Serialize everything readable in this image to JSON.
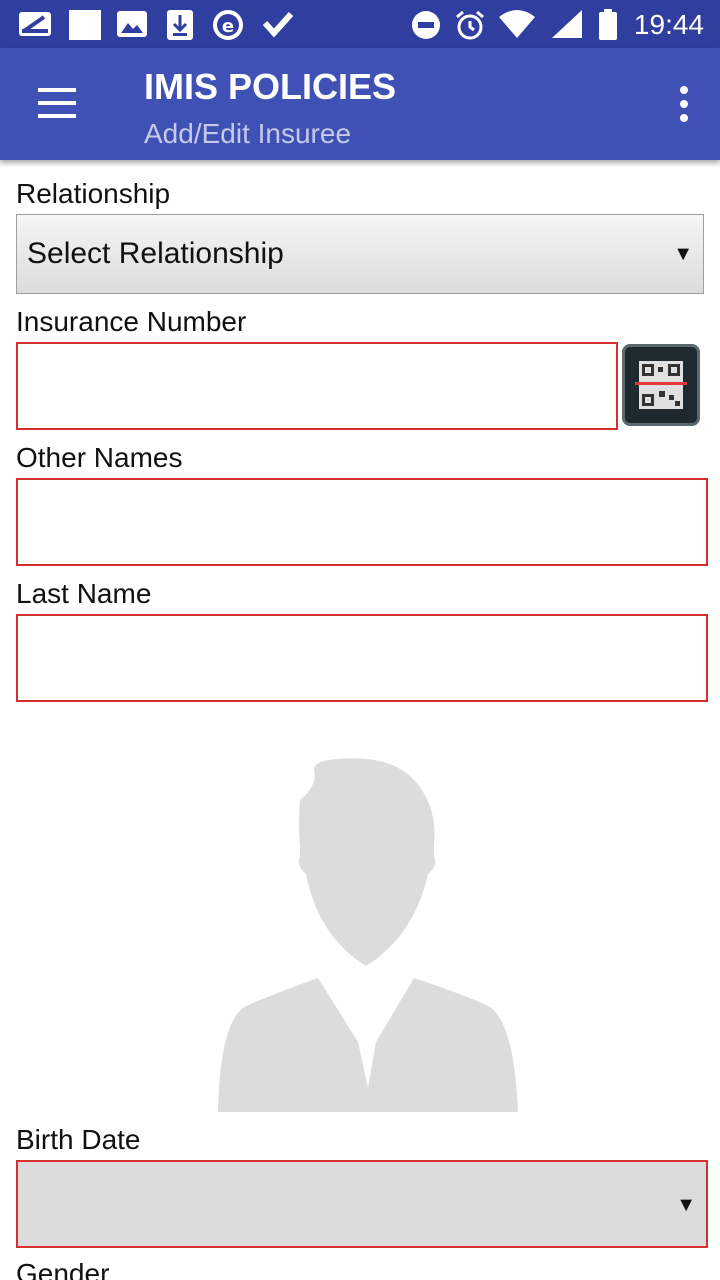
{
  "status_bar": {
    "time": "19:44"
  },
  "app_bar": {
    "title": "IMIS POLICIES",
    "subtitle": "Add/Edit Insuree"
  },
  "form": {
    "relationship": {
      "label": "Relationship",
      "selected": "Select Relationship"
    },
    "insurance_number": {
      "label": "Insurance Number",
      "value": ""
    },
    "other_names": {
      "label": "Other Names",
      "value": ""
    },
    "last_name": {
      "label": "Last Name",
      "value": ""
    },
    "birth_date": {
      "label": "Birth Date",
      "value": ""
    },
    "gender": {
      "label": "Gender"
    }
  },
  "icons": {
    "menu": "hamburger-menu-icon",
    "overflow": "more-vert-icon",
    "qr_scan": "qr-scan-icon",
    "avatar": "person-placeholder-icon",
    "dropdown": "▼"
  },
  "colors": {
    "status_bar": "#303f9f",
    "app_bar": "#3f51b5",
    "subtitle": "#c5cae9",
    "required_border": "#d32f2f",
    "avatar": "#dcdcdc"
  }
}
